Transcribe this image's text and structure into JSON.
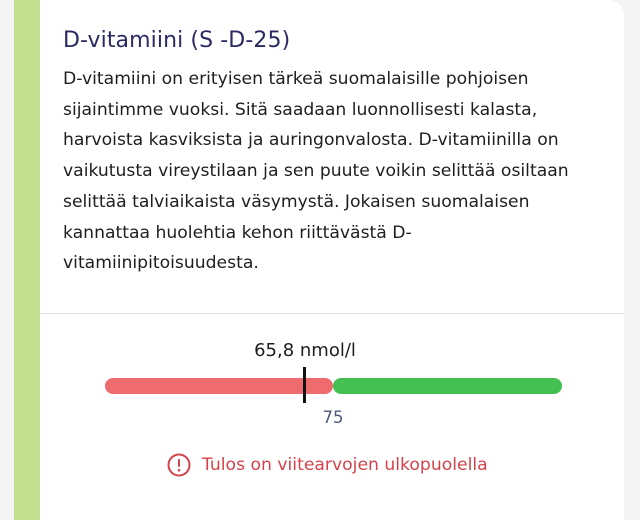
{
  "card": {
    "title": "D-vitamiini (S -D-25)",
    "description": "D-vitamiini on erityisen tärkeä suomalaisille pohjoisen sijaintimme vuoksi. Sitä saadaan luonnollisesti kalasta, harvoista kasviksista ja auringonvalosta. D-vitamiinilla on vaikutusta vireystilaan ja sen puute voikin selittää osiltaan selittää talviaikaista väsymystä. Jokaisen suomalaisen kannattaa huolehtia kehon riittävästä D-vitamiinipitoisuudesta.",
    "accent_color": "#c3e08f"
  },
  "result": {
    "value_label": "65,8 nmol/l",
    "value": 65.8,
    "threshold_label": "75",
    "threshold": 75,
    "low_color": "#ee6b6e",
    "high_color": "#44bf51"
  },
  "status": {
    "icon": "exclamation-circle-icon",
    "text": "Tulos on viitearvojen ulkopuolella",
    "color": "#d4434b"
  }
}
